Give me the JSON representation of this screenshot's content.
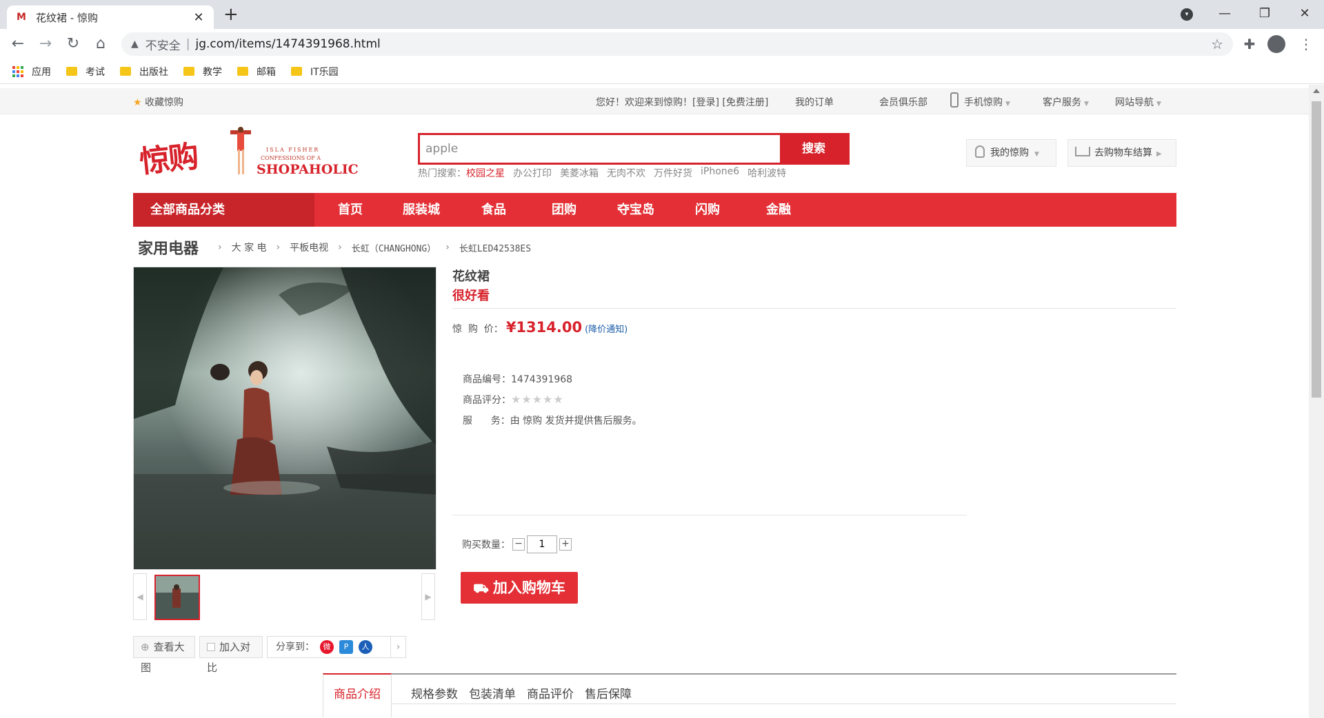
{
  "browser": {
    "tab_title": "花纹裙 - 惊购",
    "favicon_text": "M",
    "new_tab": "+",
    "close_tab": "✕",
    "insecure_label": "不安全",
    "url": "jg.com/items/1474391968.html",
    "window_controls": [
      "—",
      "❐",
      "✕"
    ]
  },
  "bookmarks": [
    "应用",
    "考试",
    "出版社",
    "教学",
    "邮箱",
    "IT乐园"
  ],
  "topbar": {
    "favorite": "收藏惊购",
    "welcome": "您好！欢迎来到惊购！[登录] [免费注册]",
    "orders": "我的订单",
    "club": "会员俱乐部",
    "mobile": "手机惊购",
    "service": "客户服务",
    "sitenav": "网站导航"
  },
  "logo": {
    "cn": "惊购",
    "en1": "ISLA FISHER",
    "en2": "CONFESSIONS OF A",
    "en3": "SHOPAHOLIC"
  },
  "search": {
    "value": "apple",
    "button": "搜索",
    "hot_label": "热门搜索：",
    "hot": [
      "校园之星",
      "办公打印",
      "美菱冰箱",
      "无肉不欢",
      "万件好货",
      "iPhone6",
      "哈利波特"
    ]
  },
  "header_buttons": {
    "my": "我的惊购",
    "cart": "去购物车结算"
  },
  "nav": {
    "all": "全部商品分类",
    "items": [
      "首页",
      "服装城",
      "食品",
      "团购",
      "夺宝岛",
      "闪购",
      "金融"
    ]
  },
  "breadcrumb": {
    "root": "家用电器",
    "items": [
      "大 家 电",
      "平板电视",
      "长虹（CHANGHONG）",
      "长虹LED42538ES"
    ]
  },
  "product": {
    "name": "花纹裙",
    "subtitle": "很好看",
    "price_label": "惊  购  价：",
    "price": "¥1314.00",
    "price_notice": "(降价通知)",
    "id_label": "商品编号：",
    "id": "1474391968",
    "rating_label": "商品评分：",
    "rating": 0,
    "service_label": "服      务：",
    "service": "由 惊购 发货并提供售后服务。",
    "qty_label": "购买数量：",
    "qty": "1",
    "add_to_cart": "加入购物车"
  },
  "tools": {
    "zoom": "查看大图",
    "compare": "加入对比",
    "share": "分享到："
  },
  "tabs": [
    "商品介绍",
    "规格参数",
    "包装清单",
    "商品评价",
    "售后保障"
  ],
  "colors": {
    "brand_red": "#e32f35",
    "dark_red": "#c8252b",
    "link_blue": "#1d5ea9"
  }
}
